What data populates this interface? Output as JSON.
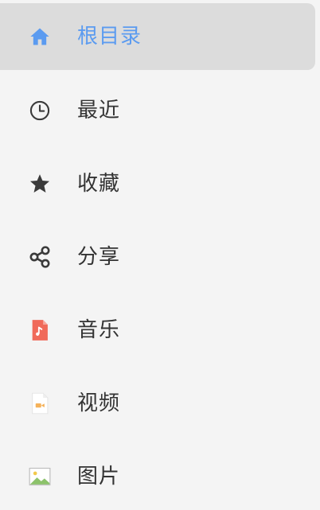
{
  "colors": {
    "background": "#f4f4f4",
    "active_background": "#dcdcdc",
    "accent": "#5b9bf0",
    "text": "#333333",
    "icon_dark": "#3a3a3a",
    "music_red": "#f06a5a",
    "video_orange": "#f5b25a",
    "image_green": "#8cc26b"
  },
  "nav": {
    "items": [
      {
        "label": "根目录",
        "icon": "home-icon",
        "active": true
      },
      {
        "label": "最近",
        "icon": "clock-icon",
        "active": false
      },
      {
        "label": "收藏",
        "icon": "star-icon",
        "active": false
      },
      {
        "label": "分享",
        "icon": "share-icon",
        "active": false
      },
      {
        "label": "音乐",
        "icon": "music-file-icon",
        "active": false
      },
      {
        "label": "视频",
        "icon": "video-file-icon",
        "active": false
      },
      {
        "label": "图片",
        "icon": "image-file-icon",
        "active": false
      }
    ]
  }
}
